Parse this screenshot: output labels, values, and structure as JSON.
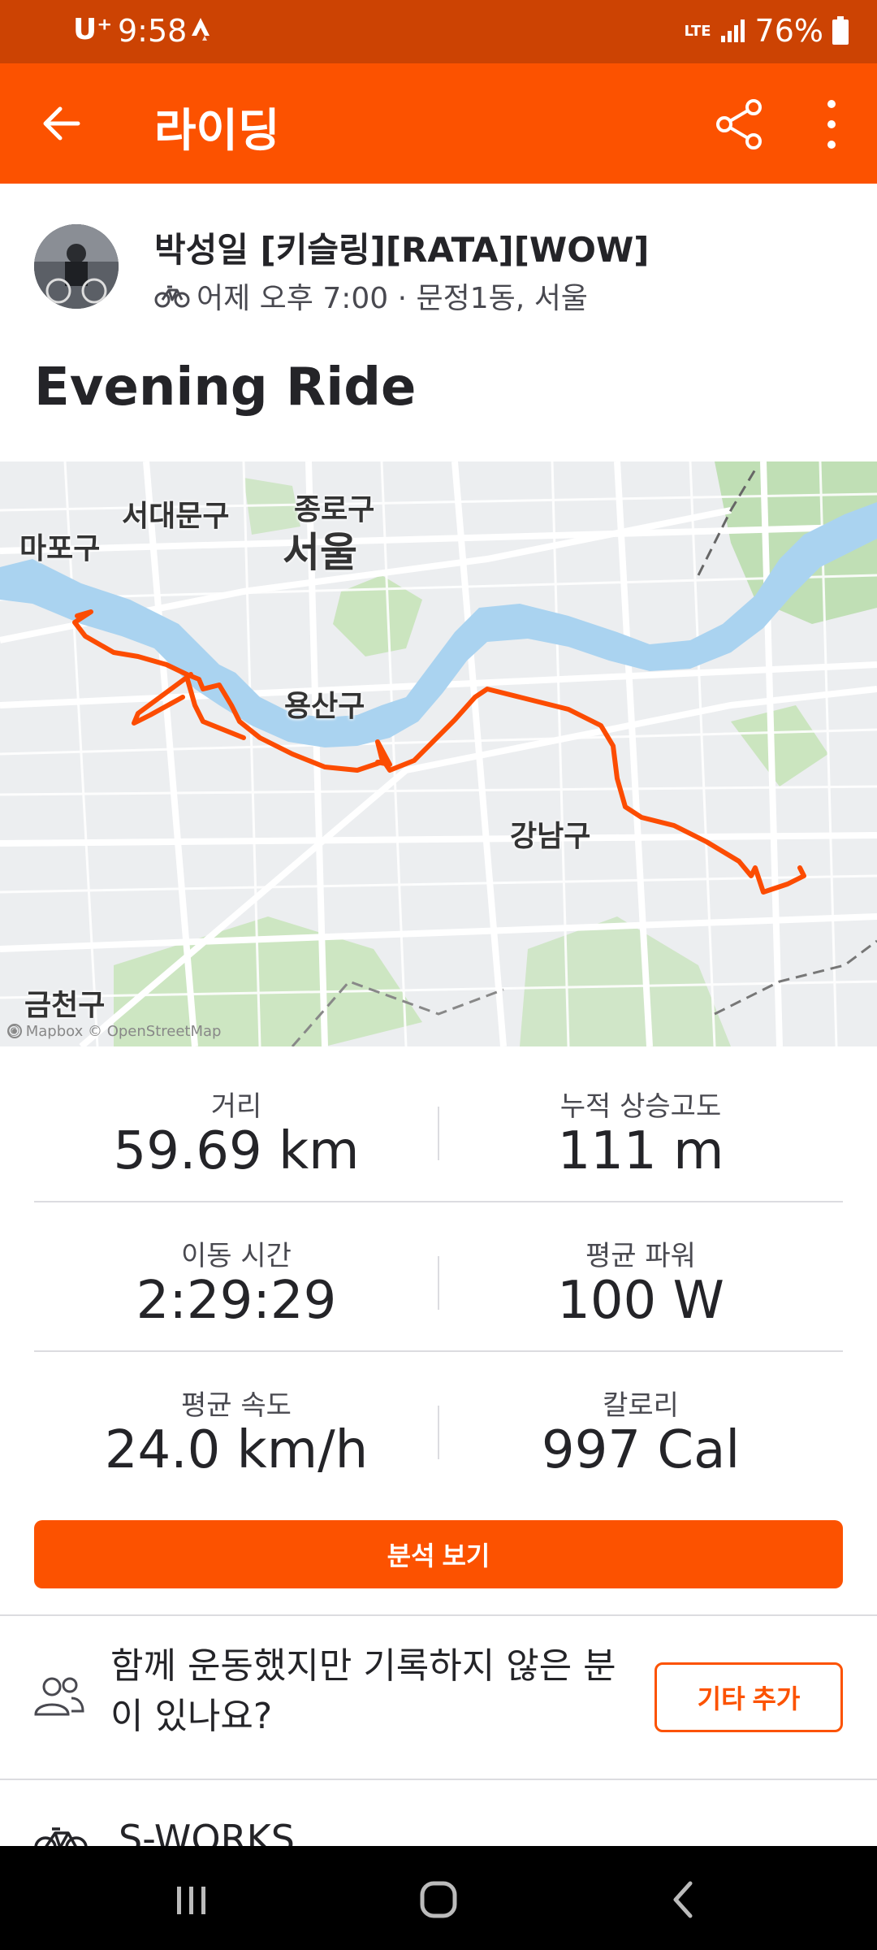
{
  "status_bar": {
    "carrier": "U⁺",
    "time": "9:58",
    "network": "LTE",
    "battery": "76%"
  },
  "app_bar": {
    "title": "라이딩"
  },
  "athlete": {
    "name": "박성일 [키슬링][RATA][WOW]",
    "meta": "어제 오후 7:00 · 문정1동, 서울"
  },
  "activity": {
    "title": "Evening Ride"
  },
  "map": {
    "labels": {
      "seodaemun": "서대문구",
      "jongno": "종로구",
      "mapo": "마포구",
      "seoul": "서울",
      "yongsan": "용산구",
      "gangnam": "강남구",
      "geumcheon": "금천구"
    },
    "attribution": "© Mapbox © OpenStreetMap",
    "colors": {
      "route": "#fc4c02",
      "river": "#aad3f0",
      "park": "#c5e3b6"
    }
  },
  "stats": {
    "distance": {
      "label": "거리",
      "value": "59.69 km"
    },
    "elevation": {
      "label": "누적 상승고도",
      "value": "111 m"
    },
    "moving_time": {
      "label": "이동 시간",
      "value": "2:29:29"
    },
    "avg_power": {
      "label": "평균 파워",
      "value": "100 W"
    },
    "avg_speed": {
      "label": "평균 속도",
      "value": "24.0 km/h"
    },
    "calories": {
      "label": "칼로리",
      "value": "997 Cal"
    }
  },
  "analysis_button": "분석 보기",
  "people_prompt": {
    "text": "함께 운동했지만 기록하지 않은 분이 있나요?",
    "button": "기타 추가"
  },
  "gear": {
    "name": "S-WORKS"
  },
  "colors": {
    "brand": "#fc5200",
    "status_bar": "#cc4303"
  }
}
